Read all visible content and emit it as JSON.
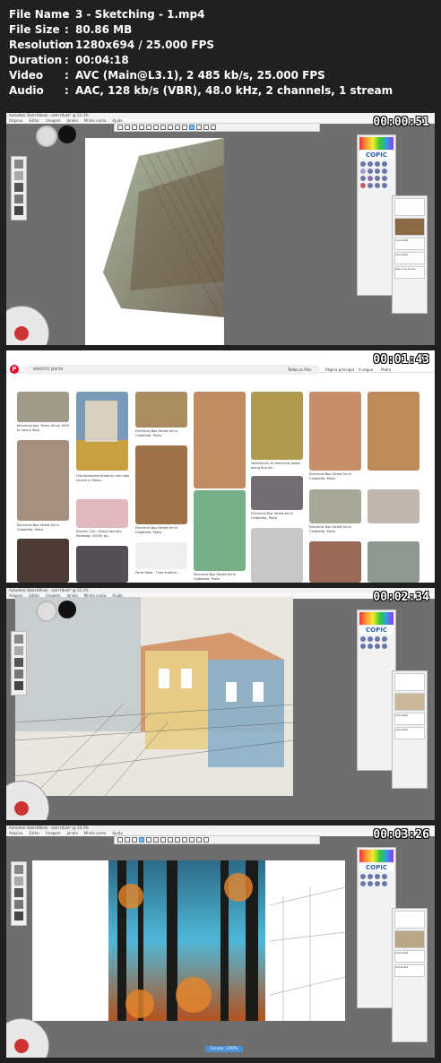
{
  "info": [
    {
      "key": "File Name",
      "value": "3 - Sketching - 1.mp4"
    },
    {
      "key": "File Size",
      "value": "80.86 MB"
    },
    {
      "key": "Resolution",
      "value": "1280x694 / 25.000 FPS"
    },
    {
      "key": "Duration",
      "value": "00:04:18"
    },
    {
      "key": "Video",
      "value": "AVC (Main@L3.1), 2 485 kb/s, 25.000 FPS"
    },
    {
      "key": "Audio",
      "value": "AAC, 128 kb/s (VBR), 48.0 kHz, 2 channels, 1 stream"
    }
  ],
  "separator": ":",
  "frames": [
    {
      "timestamp": "00:00:51"
    },
    {
      "timestamp": "00:01:43"
    },
    {
      "timestamp": "00:02:34"
    },
    {
      "timestamp": "00:03:26"
    }
  ],
  "sketchbook": {
    "window_title": "Autodesk SketchBook - sem título* @ 33.3%",
    "menu": [
      "Arquivo",
      "Editar",
      "Imagem",
      "Janela",
      "Minha conta",
      "Ajuda"
    ],
    "panel_brand": "COPIC",
    "layers": [
      "Camada2",
      "Camada1",
      "Plano de fundo"
    ],
    "zoom_text": "Escala: 226%"
  },
  "pinterest": {
    "search_text": "electric porto",
    "filter_label": "Todos os Pins",
    "nav": [
      "Página principal",
      "A seguir",
      "Pedro"
    ],
    "captions": [
      "Electrical box, Porto. Since 1999 to now a days",
      "Old-fashioned streetcar ride near church in Porto...",
      "Electrical Box Street Art in Cedofeita, Porto",
      "Electrical Box Street Art in Cedofeita, Porto",
      "Valentyna1 on electrical boxes along Rua do...",
      "Electrical Box Street Art in Cedofeita, Porto",
      "Electrical Box Street Art in Cedofeita, Porto",
      "Electric City - Brand Identity Redesign (2018) by...",
      "Electrical Box Street Art in Cedofeita, Porto",
      "Electrical Box Street Art in Cedofeita, Porto",
      "Porto Rosa - Tinta tradicio...",
      "Electrical Box Street Art in Cedofeita, Porto"
    ]
  }
}
